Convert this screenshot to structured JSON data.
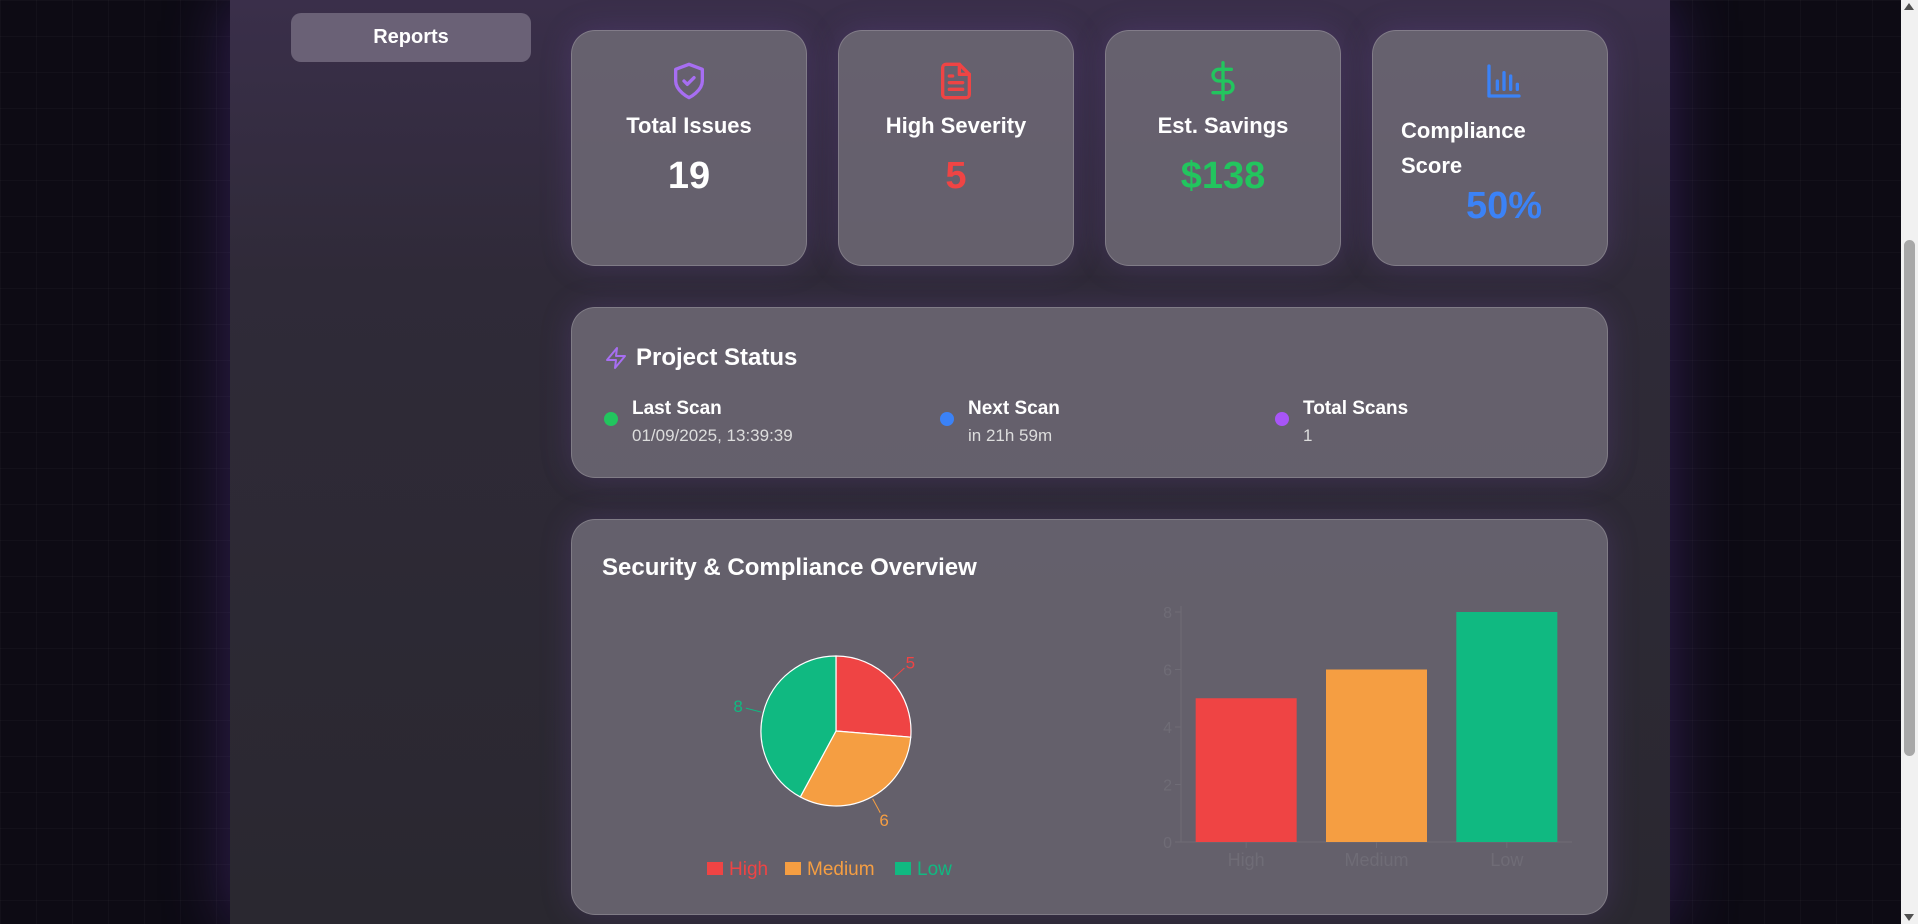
{
  "sidebar": {
    "active_item": "Reports"
  },
  "stats": [
    {
      "label": "Total Issues",
      "value": "19",
      "icon": "shield-check-icon",
      "color": "#ffffff",
      "icon_color": "#a76ef2"
    },
    {
      "label": "High Severity",
      "value": "5",
      "icon": "file-text-icon",
      "color": "#ef4444",
      "icon_color": "#ef4444"
    },
    {
      "label": "Est. Savings",
      "value": "$138",
      "icon": "dollar-icon",
      "color": "#22c55e",
      "icon_color": "#22c55e"
    },
    {
      "label": "Compliance Score",
      "value": "50%",
      "icon": "bar-chart-icon",
      "color": "#3b82f6",
      "icon_color": "#3b82f6"
    }
  ],
  "project_status": {
    "title": "Project Status",
    "items": [
      {
        "label": "Last Scan",
        "value": "01/09/2025, 13:39:39",
        "color": "#22c55e"
      },
      {
        "label": "Next Scan",
        "value": "in 21h 59m",
        "color": "#3b82f6"
      },
      {
        "label": "Total Scans",
        "value": "1",
        "color": "#a855f7"
      }
    ]
  },
  "overview": {
    "title": "Security & Compliance Overview"
  },
  "chart_data": [
    {
      "type": "pie",
      "categories": [
        "High",
        "Medium",
        "Low"
      ],
      "values": [
        5,
        6,
        8
      ],
      "colors": [
        "#ef4444",
        "#f59e42",
        "#10b981"
      ],
      "legend": "bottom"
    },
    {
      "type": "bar",
      "categories": [
        "High",
        "Medium",
        "Low"
      ],
      "values": [
        5,
        6,
        8
      ],
      "colors": [
        "#ef4444",
        "#f59e42",
        "#10b981"
      ],
      "yticks": [
        "0",
        "2",
        "4",
        "6",
        "8"
      ],
      "ylim": [
        0,
        8
      ]
    }
  ]
}
